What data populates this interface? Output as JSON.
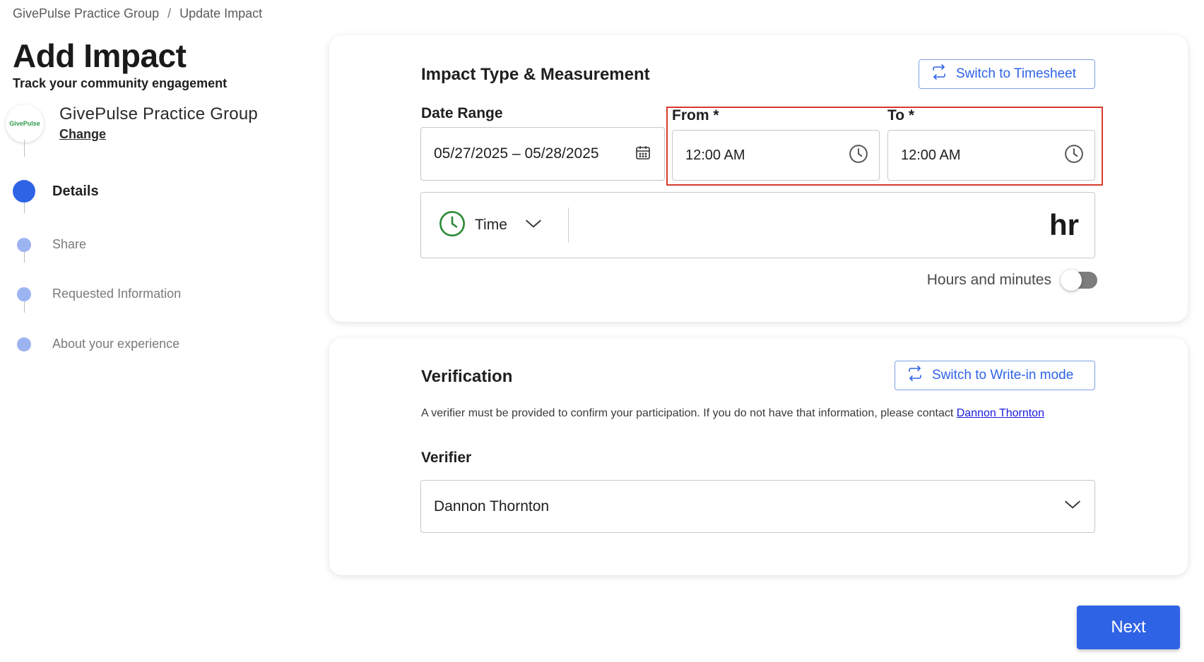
{
  "breadcrumb": {
    "group": "GivePulse Practice Group",
    "separator": "/",
    "current": "Update Impact"
  },
  "header": {
    "title": "Add Impact",
    "subtitle": "Track your community engagement"
  },
  "org": {
    "logo_text": "GivePulse",
    "name": "GivePulse Practice Group",
    "change_label": "Change"
  },
  "steps": [
    {
      "label": "Details",
      "active": true
    },
    {
      "label": "Share",
      "active": false
    },
    {
      "label": "Requested Information",
      "active": false
    },
    {
      "label": "About your experience",
      "active": false
    }
  ],
  "impact": {
    "title": "Impact Type & Measurement",
    "switch_label": "Switch to Timesheet",
    "date_range_label": "Date Range",
    "date_range_value": "05/27/2025 – 05/28/2025",
    "from_label": "From *",
    "from_value": "12:00 AM",
    "to_label": "To *",
    "to_value": "12:00 AM",
    "type_label": "Time",
    "unit": "hr",
    "toggle_label": "Hours and minutes",
    "toggle_on": false
  },
  "verification": {
    "title": "Verification",
    "switch_label": "Switch to Write-in mode",
    "description": "A verifier must be provided to confirm your participation. If you do not have that information, please contact ",
    "contact_name": "Dannon Thornton",
    "verifier_label": "Verifier",
    "verifier_value": "Dannon Thornton"
  },
  "footer": {
    "next_label": "Next"
  },
  "colors": {
    "accent": "#2f63e6",
    "step_inactive": "#9db4f2",
    "highlight": "#d83b2e",
    "time_icon": "#2e8b3a"
  },
  "icons": {
    "switch": "swap-arrows-icon",
    "calendar": "calendar-icon",
    "clock": "clock-icon",
    "chevron": "chevron-down-icon"
  }
}
